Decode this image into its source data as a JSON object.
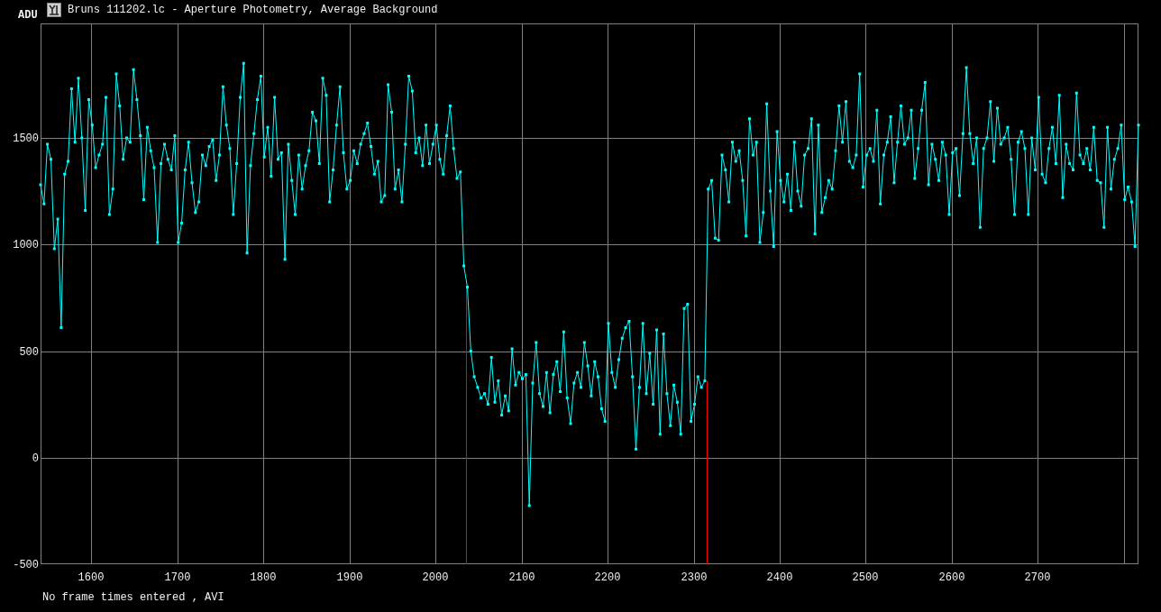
{
  "window": {
    "title": "Bruns 111202.lc - Aperture Photometry, Average Background"
  },
  "plot": {
    "chart_data": {
      "type": "line",
      "ylabel": "ADU",
      "x": [
        1541,
        1545,
        1549,
        1553,
        1557,
        1561,
        1565,
        1569,
        1573,
        1577,
        1581,
        1585,
        1589,
        1593,
        1597,
        1601,
        1605,
        1609,
        1613,
        1617,
        1621,
        1625,
        1629,
        1633,
        1637,
        1641,
        1645,
        1649,
        1653,
        1657,
        1661,
        1665,
        1669,
        1673,
        1677,
        1681,
        1685,
        1689,
        1693,
        1697,
        1701,
        1705,
        1709,
        1713,
        1717,
        1721,
        1725,
        1729,
        1733,
        1737,
        1741,
        1745,
        1749,
        1753,
        1757,
        1761,
        1765,
        1769,
        1773,
        1777,
        1781,
        1785,
        1789,
        1793,
        1797,
        1801,
        1805,
        1809,
        1813,
        1817,
        1821,
        1825,
        1829,
        1833,
        1837,
        1841,
        1845,
        1849,
        1853,
        1857,
        1861,
        1865,
        1869,
        1873,
        1877,
        1881,
        1885,
        1889,
        1893,
        1897,
        1901,
        1905,
        1909,
        1913,
        1917,
        1921,
        1925,
        1929,
        1933,
        1937,
        1941,
        1945,
        1949,
        1953,
        1957,
        1961,
        1965,
        1969,
        1973,
        1977,
        1981,
        1985,
        1989,
        1993,
        1997,
        2001,
        2005,
        2009,
        2013,
        2017,
        2021,
        2025,
        2029,
        2033,
        2037,
        2041,
        2045,
        2049,
        2053,
        2057,
        2061,
        2065,
        2069,
        2073,
        2077,
        2081,
        2085,
        2089,
        2093,
        2097,
        2101,
        2105,
        2109,
        2113,
        2117,
        2121,
        2125,
        2129,
        2133,
        2137,
        2141,
        2145,
        2149,
        2153,
        2157,
        2161,
        2165,
        2169,
        2173,
        2177,
        2181,
        2185,
        2189,
        2193,
        2197,
        2201,
        2205,
        2209,
        2213,
        2217,
        2221,
        2225,
        2229,
        2233,
        2237,
        2241,
        2245,
        2249,
        2253,
        2257,
        2261,
        2265,
        2269,
        2273,
        2277,
        2281,
        2285,
        2289,
        2293,
        2297,
        2301,
        2305,
        2309,
        2313,
        2317,
        2321,
        2325,
        2329,
        2333,
        2337,
        2341,
        2345,
        2349,
        2353,
        2357,
        2361,
        2365,
        2369,
        2373,
        2377,
        2381,
        2385,
        2389,
        2393,
        2397,
        2401,
        2405,
        2409,
        2413,
        2417,
        2421,
        2425,
        2429,
        2433,
        2437,
        2441,
        2445,
        2449,
        2453,
        2457,
        2461,
        2465,
        2469,
        2473,
        2477,
        2481,
        2485,
        2489,
        2493,
        2497,
        2501,
        2505,
        2509,
        2513,
        2517,
        2521,
        2525,
        2529,
        2533,
        2537,
        2541,
        2545,
        2549,
        2553,
        2557,
        2561,
        2565,
        2569,
        2573,
        2577,
        2581,
        2585,
        2589,
        2593,
        2597,
        2601,
        2605,
        2609,
        2613,
        2617,
        2621,
        2625,
        2629,
        2633,
        2637,
        2641,
        2645,
        2649,
        2653,
        2657,
        2661,
        2665,
        2669,
        2673,
        2677,
        2681,
        2685,
        2689,
        2693,
        2697,
        2701,
        2705,
        2709,
        2713,
        2717,
        2721,
        2725,
        2729,
        2733,
        2737,
        2741,
        2745,
        2749,
        2753,
        2757,
        2761,
        2765,
        2769,
        2773,
        2777,
        2781,
        2785,
        2789,
        2793,
        2797,
        2801,
        2805,
        2809,
        2813,
        2817
      ],
      "series": [
        {
          "color": "#00ffff",
          "marker": "square",
          "values": [
            1280,
            1190,
            1470,
            1400,
            980,
            1120,
            610,
            1330,
            1390,
            1730,
            1480,
            1780,
            1500,
            1160,
            1680,
            1560,
            1360,
            1420,
            1470,
            1690,
            1140,
            1260,
            1800,
            1650,
            1400,
            1500,
            1480,
            1820,
            1680,
            1510,
            1210,
            1550,
            1440,
            1360,
            1010,
            1380,
            1470,
            1400,
            1350,
            1510,
            1010,
            1100,
            1350,
            1480,
            1290,
            1150,
            1200,
            1420,
            1370,
            1460,
            1490,
            1300,
            1420,
            1740,
            1560,
            1450,
            1140,
            1380,
            1690,
            1850,
            960,
            1370,
            1520,
            1680,
            1790,
            1410,
            1550,
            1320,
            1690,
            1400,
            1430,
            930,
            1470,
            1300,
            1140,
            1420,
            1260,
            1370,
            1440,
            1620,
            1580,
            1380,
            1780,
            1700,
            1200,
            1350,
            1560,
            1740,
            1430,
            1260,
            1300,
            1440,
            1380,
            1470,
            1520,
            1570,
            1460,
            1330,
            1390,
            1200,
            1230,
            1750,
            1620,
            1260,
            1350,
            1200,
            1470,
            1790,
            1720,
            1430,
            1500,
            1370,
            1560,
            1380,
            1470,
            1560,
            1400,
            1330,
            1510,
            1650,
            1450,
            1310,
            1340,
            900,
            800,
            500,
            380,
            330,
            280,
            300,
            250,
            470,
            260,
            360,
            200,
            290,
            220,
            510,
            340,
            400,
            370,
            390,
            -225,
            350,
            540,
            300,
            240,
            400,
            210,
            390,
            450,
            310,
            590,
            280,
            160,
            350,
            400,
            330,
            540,
            430,
            290,
            450,
            380,
            230,
            170,
            630,
            400,
            330,
            460,
            560,
            610,
            640,
            380,
            40,
            330,
            630,
            300,
            490,
            250,
            600,
            110,
            580,
            300,
            150,
            340,
            260,
            110,
            700,
            720,
            170,
            250,
            380,
            330,
            360,
            1260,
            1300,
            1030,
            1020,
            1420,
            1350,
            1200,
            1480,
            1390,
            1440,
            1300,
            1040,
            1590,
            1420,
            1480,
            1010,
            1150,
            1660,
            1250,
            990,
            1530,
            1300,
            1200,
            1330,
            1160,
            1480,
            1250,
            1180,
            1420,
            1450,
            1590,
            1050,
            1560,
            1150,
            1220,
            1300,
            1260,
            1440,
            1650,
            1480,
            1670,
            1390,
            1360,
            1420,
            1800,
            1270,
            1420,
            1450,
            1390,
            1630,
            1190,
            1420,
            1480,
            1600,
            1290,
            1480,
            1650,
            1470,
            1500,
            1630,
            1310,
            1450,
            1630,
            1760,
            1280,
            1470,
            1400,
            1300,
            1480,
            1420,
            1140,
            1430,
            1450,
            1230,
            1520,
            1830,
            1520,
            1380,
            1500,
            1080,
            1450,
            1500,
            1670,
            1390,
            1640,
            1470,
            1500,
            1550,
            1400,
            1140,
            1480,
            1530,
            1450,
            1140,
            1500,
            1350,
            1690,
            1330,
            1290,
            1450,
            1550,
            1380,
            1700,
            1220,
            1470,
            1380,
            1350,
            1710,
            1420,
            1380,
            1450,
            1350,
            1550,
            1300,
            1290,
            1080,
            1550,
            1260,
            1400,
            1450,
            1560,
            1210,
            1270,
            1200,
            990,
            1560
          ]
        }
      ],
      "xlim": [
        1541,
        2817
      ],
      "ylim": [
        -500,
        2037
      ],
      "xticks": [
        1600,
        1700,
        1800,
        1900,
        2000,
        2100,
        2200,
        2300,
        2400,
        2500,
        2600,
        2700
      ],
      "yticks": [
        -500,
        0,
        500,
        1000,
        1500
      ],
      "grid": true,
      "ref_lines": [
        {
          "axis": "x",
          "value": 2035,
          "color": "#ff0000"
        },
        {
          "axis": "x",
          "value": 2315,
          "color": "#ff0000"
        }
      ]
    }
  },
  "status_bar": {
    "text": "No frame times entered , AVI"
  }
}
